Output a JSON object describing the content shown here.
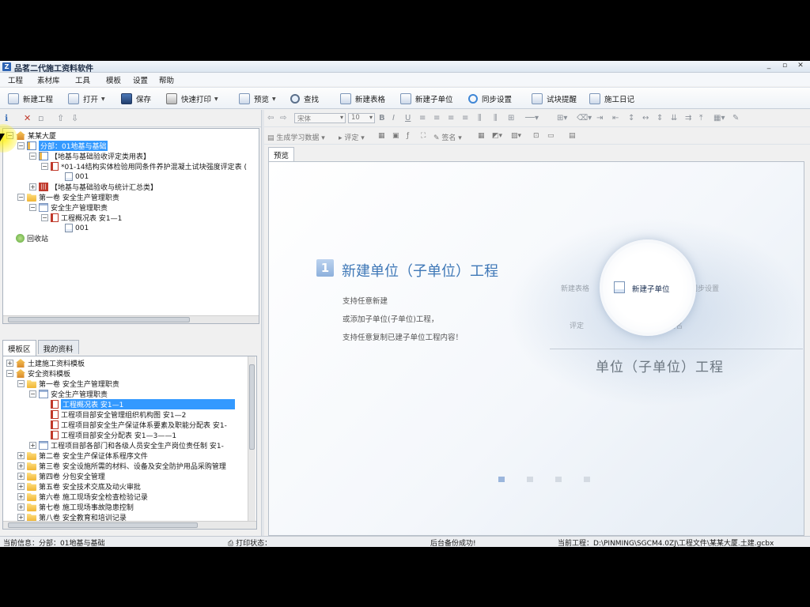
{
  "window": {
    "title": "品茗二代施工资料软件",
    "controls": [
      "_",
      "▫",
      "✕"
    ]
  },
  "menu": [
    "工程",
    "素材库",
    "工具",
    "模板",
    "设置",
    "帮助"
  ],
  "toolbar": {
    "new_project": "新建工程",
    "open": "打开",
    "save": "保存",
    "quick_print": "快速打印",
    "preview": "预览",
    "find": "查找",
    "new_table": "新建表格",
    "new_sub_unit": "新建子单位",
    "sync_settings": "同步设置",
    "sample_reminder": "试块提醒",
    "construction_log": "施工日记"
  },
  "project_tree": [
    {
      "label": "某某大厦",
      "icon": "house"
    },
    {
      "label": "分部：01地基与基础",
      "icon": "category",
      "selected": true
    },
    {
      "label": "【地基与基础验收评定类用表】",
      "icon": "category"
    },
    {
      "label": "*01-14结构实体检验用同条件养护混凝土试块强度评定表 (",
      "icon": "sheet-red"
    },
    {
      "label": "001",
      "icon": "doc"
    },
    {
      "label": "【地基与基础验收与统计汇总类】",
      "icon": "red-badge"
    },
    {
      "label": "第一卷  安全生产管理职责",
      "icon": "folder"
    },
    {
      "label": "安全生产管理职责",
      "icon": "sheet"
    },
    {
      "label": "工程概况表  安1—1",
      "icon": "sheet-red"
    },
    {
      "label": "001",
      "icon": "doc"
    },
    {
      "label": "回收站",
      "icon": "recycle"
    }
  ],
  "tabs": {
    "templates": "模板区",
    "my_data": "我的资料"
  },
  "template_tree": [
    {
      "label": "土建施工资料模板"
    },
    {
      "label": "安全资料模板"
    },
    {
      "label": "第一卷  安全生产管理职责"
    },
    {
      "label": "安全生产管理职责"
    },
    {
      "label": "工程概况表  安1—1",
      "selected": true
    },
    {
      "label": "工程项目部安全管理组织机构图  安1—2"
    },
    {
      "label": "工程项目部安全生产保证体系要素及职能分配表  安1-"
    },
    {
      "label": "工程项目部安全分配表  安1—3——1"
    },
    {
      "label": "工程项目部各部门和各级人员安全生产岗位责任制    安1-"
    },
    {
      "label": "第二卷  安全生产保证体系程序文件"
    },
    {
      "label": "第三卷  安全设施所需的材料、设备及安全防护用品采购管理"
    },
    {
      "label": "第四卷  分包安全管理"
    },
    {
      "label": "第五卷  安全技术交底及动火审批"
    },
    {
      "label": "第六卷  施工现场安全检查检验记录"
    },
    {
      "label": "第七卷  施工现场事故隐患控制"
    },
    {
      "label": "第八卷  安全教育和培训记录"
    }
  ],
  "editor": {
    "font": "宋体",
    "size": "10",
    "generate": "生成学习数据",
    "evaluate": "评定",
    "sign": "签名",
    "preview_tab": "预览"
  },
  "guide": {
    "step": "1",
    "title": "新建单位（子单位）工程",
    "lines": [
      "支持任意新建",
      "或添加子单位(子单位)工程，",
      "支持任意复制已建子单位工程内容！"
    ],
    "ghost_new_table": "新建表格",
    "ghost_sync": "同步设置",
    "lens_label": "新建子单位",
    "ghost_evaluate": "评定",
    "ghost_sign": "签名",
    "ghost_heading": "单位（子单位）工程",
    "slides": 4,
    "current_slide": 1
  },
  "status": {
    "current_info": "当前信息：分部：01地基与基础",
    "print_state": "打印状态：",
    "backup": "后台备份成功!",
    "current_project": "当前工程：D:\\PINMING\\SGCM4.0ZJ\\工程文件\\某某大厦.土建.gcbx"
  },
  "colors": {
    "accent": "#3399ff",
    "guide_title": "#3f78b7"
  }
}
